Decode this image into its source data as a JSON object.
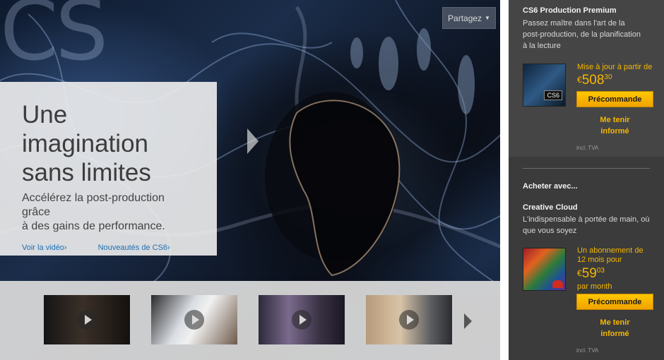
{
  "hero": {
    "logo_text": "CS",
    "share_label": "Partagez",
    "title_lines": [
      "Une",
      "imagination",
      "sans limites"
    ],
    "subtitle_lines": [
      "Accélérez la post-production grâce",
      "à des gains de performance."
    ],
    "link_video": "Voir la vidéo›",
    "link_new": "Nouveautés de CS6›"
  },
  "thumbnails": [
    {
      "name": "video-thumb-1"
    },
    {
      "name": "video-thumb-2"
    },
    {
      "name": "video-thumb-3"
    },
    {
      "name": "video-thumb-4"
    }
  ],
  "sidebar": {
    "product": {
      "title": "CS6 Production Premium",
      "desc_lines": [
        "Passez maître dans l'art de la",
        "post-production, de la planification",
        "à la lecture"
      ],
      "price_label": "Mise à jour à partir de",
      "currency": "€",
      "price_int": "508",
      "price_dec": "30",
      "box_tag": "CS6",
      "cta": "Précommande",
      "notify_lines": [
        "Me tenir",
        "informé"
      ],
      "tax": "incl. TVA"
    },
    "buy_with": "Acheter avec...",
    "cloud": {
      "title": "Creative Cloud",
      "desc_lines": [
        "L'indispensable à portée de main, où",
        "que vous soyez"
      ],
      "price_label_lines": [
        "Un abonnement de",
        "12 mois pour"
      ],
      "currency": "€",
      "price_int": "59",
      "price_dec": "03",
      "per": "par month",
      "cta": "Précommande",
      "notify_lines": [
        "Me tenir",
        "informé"
      ],
      "tax": "incl. TVA"
    }
  },
  "colors": {
    "accent": "#f6b700",
    "link": "#1f6fb2",
    "sidebar_bg": "#3b3b3b"
  }
}
